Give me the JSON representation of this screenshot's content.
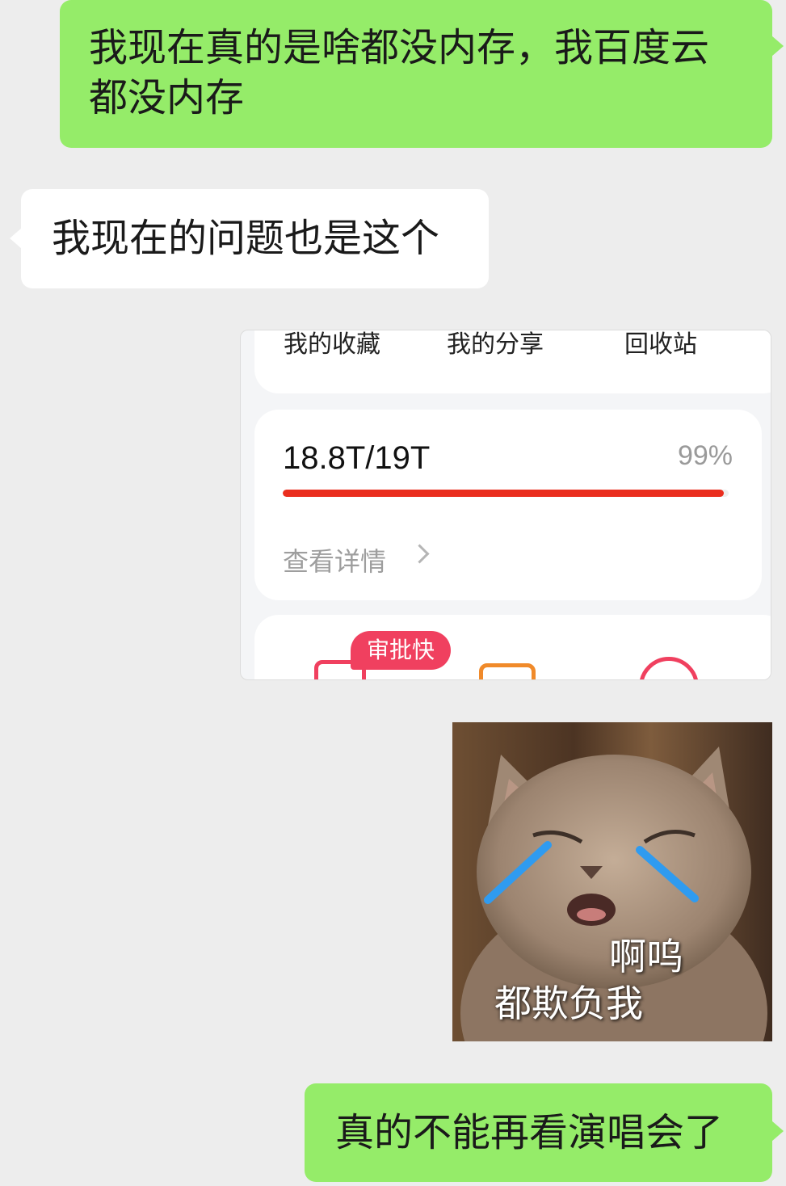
{
  "messages": [
    {
      "side": "sent",
      "text": "我现在真的是啥都没内存，我百度云都没内存"
    },
    {
      "side": "received",
      "text": "我现在的问题也是这个"
    },
    {
      "side": "sent",
      "text": "真的不能再看演唱会了"
    }
  ],
  "screenshot": {
    "quick_links": [
      "我的收藏",
      "我的分享",
      "回收站"
    ],
    "storage_used_total": "18.8T/19T",
    "storage_percent": "99%",
    "storage_fraction": 0.99,
    "details_link": "查看详情",
    "badge": "审批快",
    "colors": {
      "bar": "#ea2e1e",
      "badge": "#f0405f"
    }
  },
  "sticker": {
    "line1": "啊呜",
    "line2": "都欺负我"
  },
  "colors": {
    "sent_bubble": "#95ec69",
    "received_bubble": "#ffffff",
    "background": "#ededed"
  }
}
